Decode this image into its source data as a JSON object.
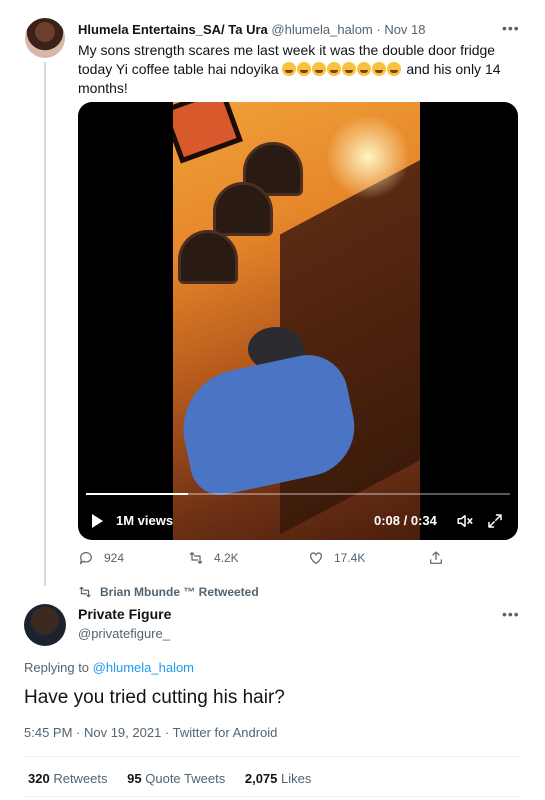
{
  "quoted_tweet": {
    "author_name": "Hlumela Entertains_SA/ Ta Ura",
    "handle": "@hlumela_halom",
    "separator": " · ",
    "date": "Nov 18",
    "more_icon": "more-horizontal-icon",
    "text_part1": "My sons strength scares me last week it was the double door fridge today Yi coffee table hai ndoyika",
    "emoji_count": 8,
    "emoji_icon": "face-with-tears-of-joy-emoji",
    "text_part2": "and his only 14 months!",
    "video": {
      "views": "1M views",
      "time": "0:08 / 0:34",
      "progress": 0.24,
      "play_icon": "play-icon",
      "volume_icon": "volume-icon",
      "expand_icon": "expand-icon"
    },
    "actions": {
      "replies": "924",
      "retweets": "4.2K",
      "likes": "17.4K"
    }
  },
  "main_tweet": {
    "retweeted_by": "Brian Mbunde ™ Retweeted",
    "author_name": "Private Figure",
    "handle": "@privatefigure_",
    "replying_label": "Replying to ",
    "replying_handle": "@hlumela_halom",
    "text": "Have you tried cutting his hair?",
    "timestamp": "5:45 PM · Nov 19, 2021 · Twitter for Android",
    "stats": {
      "retweets_count": "320",
      "retweets_label": "Retweets",
      "quotes_count": "95",
      "quotes_label": "Quote Tweets",
      "likes_count": "2,075",
      "likes_label": "Likes"
    }
  },
  "colors": {
    "text": "#0f1419",
    "secondary": "#536471",
    "link": "#1d9bf0",
    "divider": "#eff3f4"
  }
}
